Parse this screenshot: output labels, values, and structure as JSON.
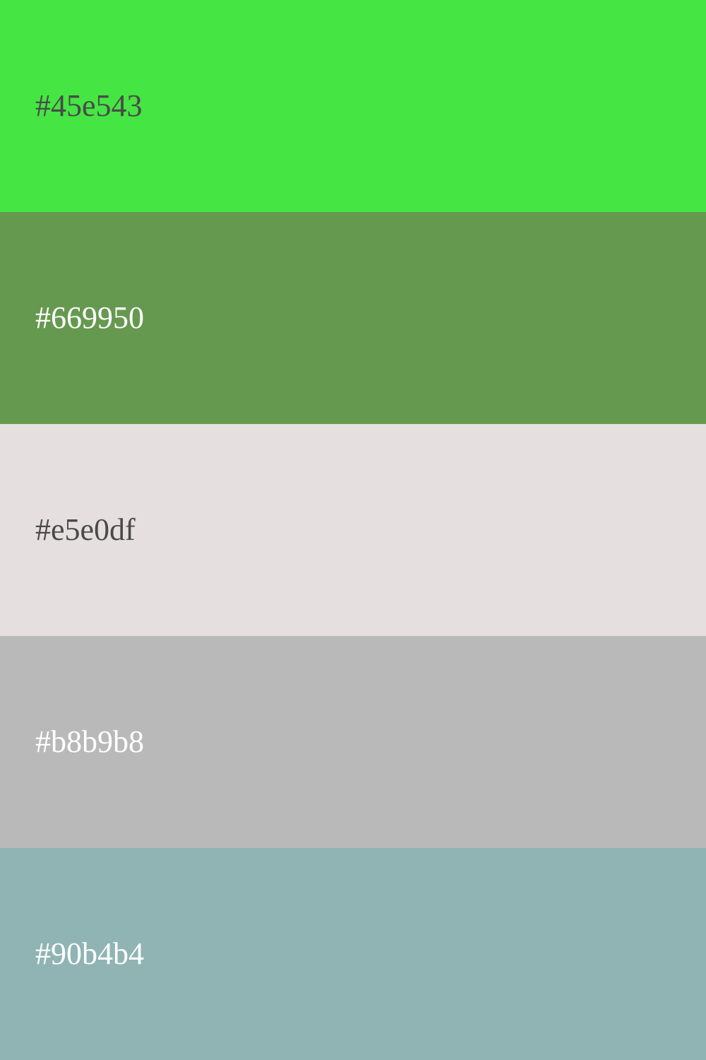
{
  "palette": {
    "swatches": [
      {
        "label": "#45e543",
        "color": "#45e543",
        "text_color": "#4a4a4a"
      },
      {
        "label": "#669950",
        "color": "#669950",
        "text_color": "#ffffff"
      },
      {
        "label": "#e5e0df",
        "color": "#e5e0df",
        "text_color": "#4a4a4a"
      },
      {
        "label": "#b8b9b8",
        "color": "#b8b9b8",
        "text_color": "#ffffff"
      },
      {
        "label": "#90b4b4",
        "color": "#90b4b4",
        "text_color": "#ffffff"
      }
    ]
  }
}
